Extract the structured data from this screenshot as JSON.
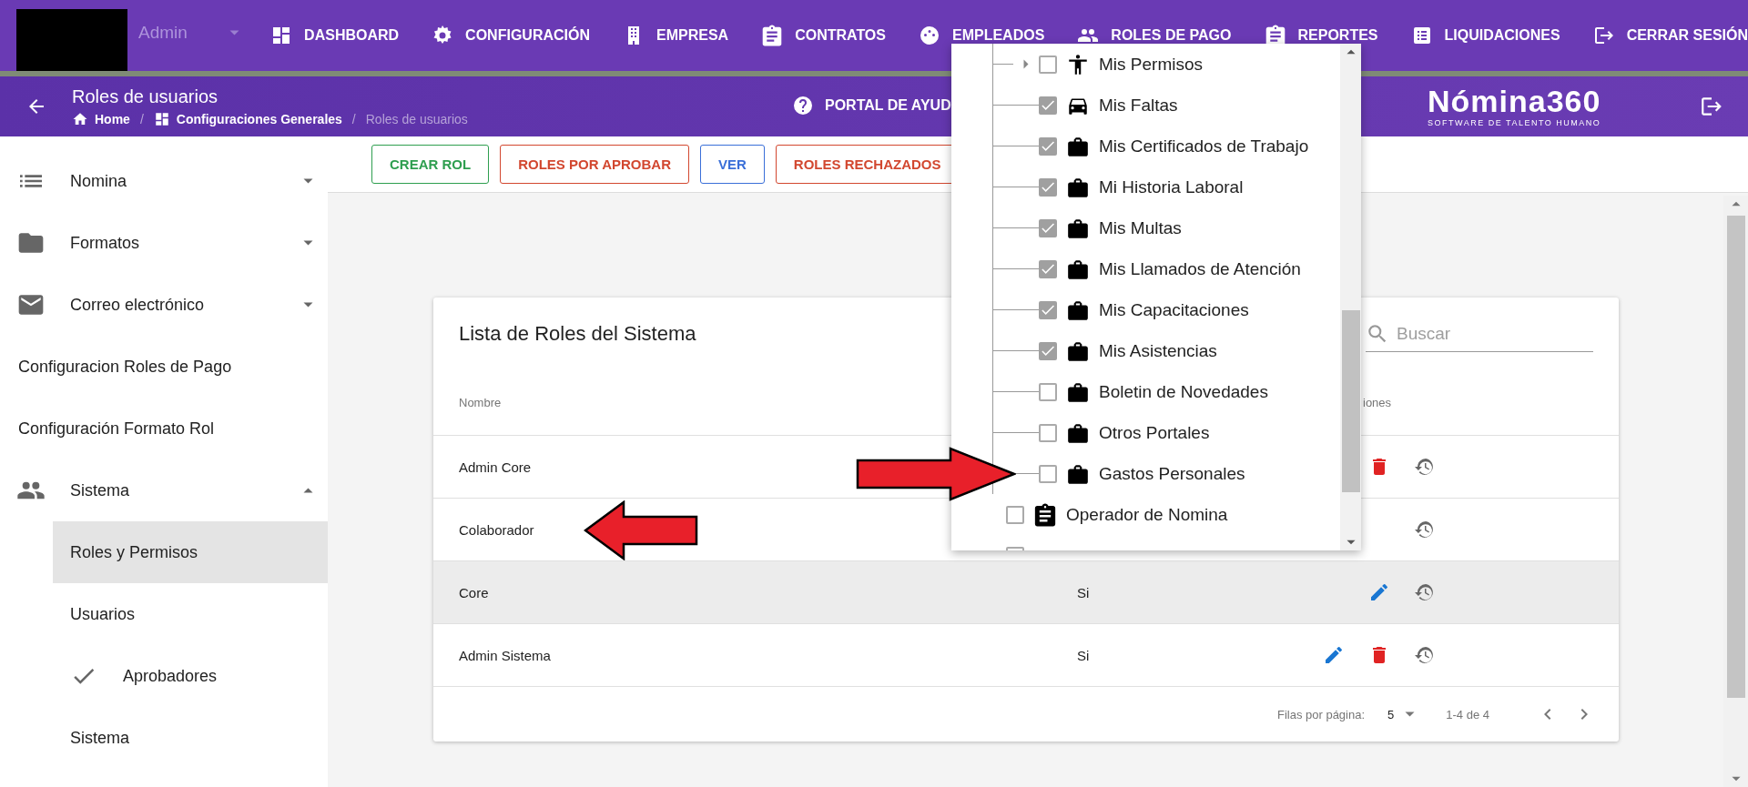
{
  "top_nav": {
    "role_select": {
      "value": "Admin"
    },
    "items": [
      {
        "label": "DASHBOARD"
      },
      {
        "label": "CONFIGURACIÓN"
      },
      {
        "label": "EMPRESA"
      },
      {
        "label": "CONTRATOS"
      },
      {
        "label": "EMPLEADOS"
      },
      {
        "label": "ROLES DE PAGO"
      },
      {
        "label": "REPORTES"
      },
      {
        "label": "LIQUIDACIONES"
      },
      {
        "label": "CERRAR SESIÓN"
      }
    ]
  },
  "page_header": {
    "title": "Roles de usuarios",
    "breadcrumbs": [
      {
        "label": "Home",
        "current": false
      },
      {
        "label": "Configuraciones Generales",
        "current": false
      },
      {
        "label": "Roles de usuarios",
        "current": true
      }
    ],
    "breadcrumb_separator": "/",
    "help_link": "PORTAL DE AYUD",
    "logo": {
      "name": "Nómina360",
      "tagline": "SOFTWARE DE TALENTO HUMANO"
    }
  },
  "sidebar": {
    "items": [
      {
        "label": "Nomina",
        "expanded": false,
        "selected": false
      },
      {
        "label": "Formatos",
        "expanded": false,
        "selected": false
      },
      {
        "label": "Correo electrónico",
        "expanded": false,
        "selected": false
      },
      {
        "label": "Configuracion Roles de Pago",
        "selected": false
      },
      {
        "label": "Configuración Formato Rol",
        "selected": false
      },
      {
        "label": "Sistema",
        "expanded": true,
        "selected": false,
        "children": [
          {
            "label": "Roles y Permisos",
            "selected": true
          },
          {
            "label": "Usuarios",
            "selected": false
          },
          {
            "label": "Aprobadores",
            "selected": false
          },
          {
            "label": "Sistema",
            "selected": false
          }
        ]
      }
    ]
  },
  "toolbar": {
    "buttons": [
      {
        "label": "CREAR ROL",
        "color": "#2e9e4f"
      },
      {
        "label": "ROLES POR APROBAR",
        "color": "#d2472f"
      },
      {
        "label": "VER",
        "color": "#3a6fd8"
      },
      {
        "label": "ROLES RECHAZADOS",
        "color": "#d2472f"
      }
    ]
  },
  "roles_table": {
    "title": "Lista de Roles del Sistema",
    "search": {
      "placeholder": "Buscar"
    },
    "headers": {
      "name": "Nombre",
      "column_3": "iones"
    },
    "rows": [
      {
        "name": "Admin Core",
        "highlighted": false,
        "actions": [
          {
            "kind": "delete"
          },
          {
            "kind": "history"
          }
        ]
      },
      {
        "name": "Colaborador",
        "highlighted": false,
        "actions": [
          {
            "kind": "history"
          }
        ]
      },
      {
        "name": "Core",
        "column_2": "Si",
        "highlighted": true,
        "actions": [
          {
            "kind": "edit"
          },
          {
            "kind": "history"
          }
        ]
      },
      {
        "name": "Admin Sistema",
        "column_2": "Si",
        "highlighted": false,
        "actions": [
          {
            "kind": "edit"
          },
          {
            "kind": "delete"
          },
          {
            "kind": "history"
          }
        ]
      }
    ],
    "footer": {
      "rows_per_page_label": "Filas por página:",
      "rows_per_page": "5",
      "range": "1-4 de 4"
    }
  },
  "permission_dropdown": {
    "nodes": [
      {
        "children": [
          {
            "label": "Mis Permisos",
            "checked": false,
            "expanded": false
          },
          {
            "label": "Mis Faltas",
            "checked": true
          },
          {
            "label": "Mis Certificados de Trabajo",
            "checked": true
          },
          {
            "label": "Mi Historia Laboral",
            "checked": true
          },
          {
            "label": "Mis Multas",
            "checked": true
          },
          {
            "label": "Mis Llamados de Atención",
            "checked": true
          },
          {
            "label": "Mis Capacitaciones",
            "checked": true
          },
          {
            "label": "Mis Asistencias",
            "checked": true
          },
          {
            "label": "Boletin de Novedades",
            "checked": false
          },
          {
            "label": "Otros Portales",
            "checked": false
          },
          {
            "label": "Gastos Personales",
            "checked": false
          }
        ]
      },
      {
        "label": "Operador de Nomina",
        "checked": false
      },
      {
        "checked": false
      }
    ]
  }
}
